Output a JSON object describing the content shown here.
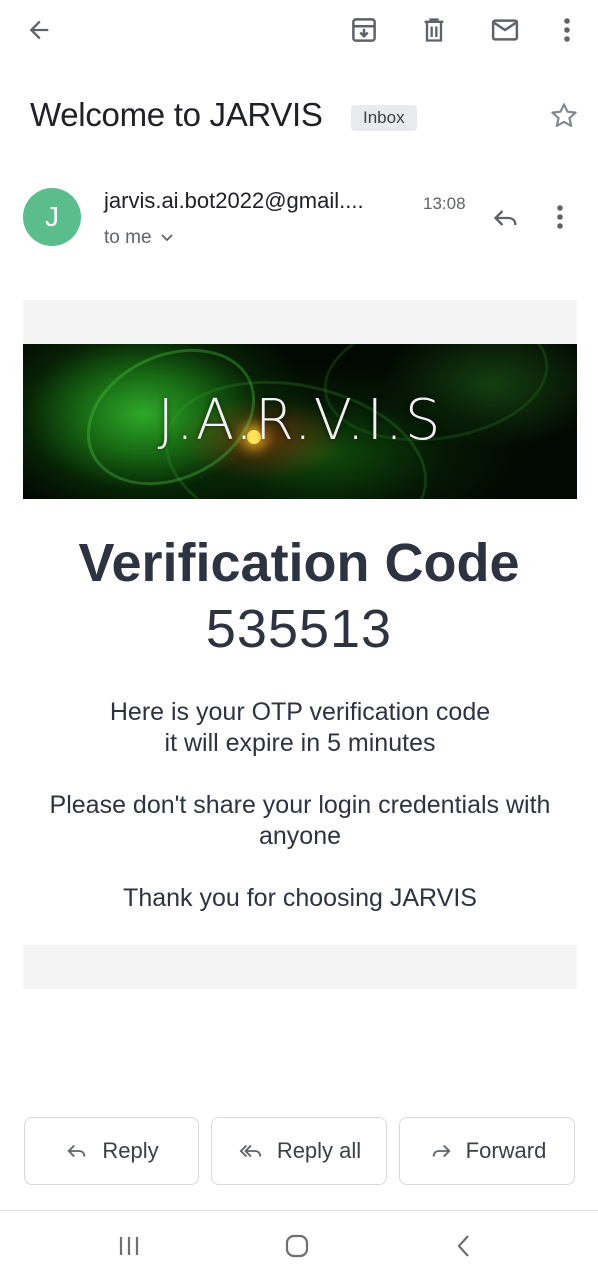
{
  "toolbar": {
    "back_icon": "arrow-back-icon",
    "archive_icon": "archive-icon",
    "delete_icon": "trash-icon",
    "mark_unread_icon": "mail-icon",
    "more_icon": "more-vert-icon"
  },
  "email": {
    "subject": "Welcome to JARVIS",
    "label": "Inbox",
    "sender_initial": "J",
    "sender": "jarvis.ai.bot2022@gmail....",
    "time": "13:08",
    "recipient": "to me"
  },
  "body": {
    "banner_text": "J.A.R.V.I.S",
    "title": "Verification Code",
    "code": "535513",
    "line1": "Here is your OTP verification code",
    "line2": "it will expire in 5 minutes",
    "warning": "Please don't share your login credentials with anyone",
    "thanks": "Thank you for choosing JARVIS"
  },
  "actions": {
    "reply": "Reply",
    "reply_all": "Reply all",
    "forward": "Forward"
  },
  "colors": {
    "avatar": "#5cbd8c",
    "text_dark": "#2d3340",
    "chip_bg": "#e8eaed"
  }
}
